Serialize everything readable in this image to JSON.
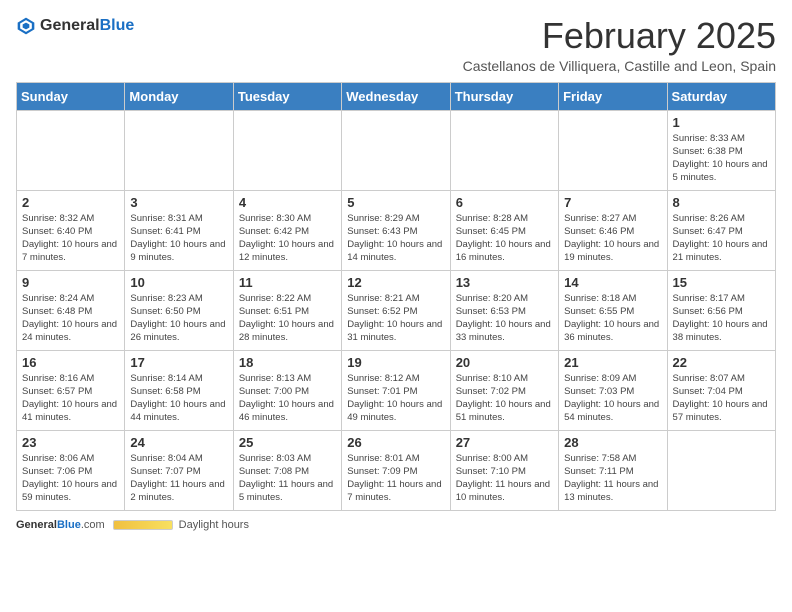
{
  "header": {
    "logo_general": "General",
    "logo_blue": "Blue",
    "title": "February 2025",
    "subtitle": "Castellanos de Villiquera, Castille and Leon, Spain"
  },
  "calendar": {
    "days_of_week": [
      "Sunday",
      "Monday",
      "Tuesday",
      "Wednesday",
      "Thursday",
      "Friday",
      "Saturday"
    ],
    "weeks": [
      [
        {
          "day": "",
          "info": ""
        },
        {
          "day": "",
          "info": ""
        },
        {
          "day": "",
          "info": ""
        },
        {
          "day": "",
          "info": ""
        },
        {
          "day": "",
          "info": ""
        },
        {
          "day": "",
          "info": ""
        },
        {
          "day": "1",
          "info": "Sunrise: 8:33 AM\nSunset: 6:38 PM\nDaylight: 10 hours and 5 minutes."
        }
      ],
      [
        {
          "day": "2",
          "info": "Sunrise: 8:32 AM\nSunset: 6:40 PM\nDaylight: 10 hours and 7 minutes."
        },
        {
          "day": "3",
          "info": "Sunrise: 8:31 AM\nSunset: 6:41 PM\nDaylight: 10 hours and 9 minutes."
        },
        {
          "day": "4",
          "info": "Sunrise: 8:30 AM\nSunset: 6:42 PM\nDaylight: 10 hours and 12 minutes."
        },
        {
          "day": "5",
          "info": "Sunrise: 8:29 AM\nSunset: 6:43 PM\nDaylight: 10 hours and 14 minutes."
        },
        {
          "day": "6",
          "info": "Sunrise: 8:28 AM\nSunset: 6:45 PM\nDaylight: 10 hours and 16 minutes."
        },
        {
          "day": "7",
          "info": "Sunrise: 8:27 AM\nSunset: 6:46 PM\nDaylight: 10 hours and 19 minutes."
        },
        {
          "day": "8",
          "info": "Sunrise: 8:26 AM\nSunset: 6:47 PM\nDaylight: 10 hours and 21 minutes."
        }
      ],
      [
        {
          "day": "9",
          "info": "Sunrise: 8:24 AM\nSunset: 6:48 PM\nDaylight: 10 hours and 24 minutes."
        },
        {
          "day": "10",
          "info": "Sunrise: 8:23 AM\nSunset: 6:50 PM\nDaylight: 10 hours and 26 minutes."
        },
        {
          "day": "11",
          "info": "Sunrise: 8:22 AM\nSunset: 6:51 PM\nDaylight: 10 hours and 28 minutes."
        },
        {
          "day": "12",
          "info": "Sunrise: 8:21 AM\nSunset: 6:52 PM\nDaylight: 10 hours and 31 minutes."
        },
        {
          "day": "13",
          "info": "Sunrise: 8:20 AM\nSunset: 6:53 PM\nDaylight: 10 hours and 33 minutes."
        },
        {
          "day": "14",
          "info": "Sunrise: 8:18 AM\nSunset: 6:55 PM\nDaylight: 10 hours and 36 minutes."
        },
        {
          "day": "15",
          "info": "Sunrise: 8:17 AM\nSunset: 6:56 PM\nDaylight: 10 hours and 38 minutes."
        }
      ],
      [
        {
          "day": "16",
          "info": "Sunrise: 8:16 AM\nSunset: 6:57 PM\nDaylight: 10 hours and 41 minutes."
        },
        {
          "day": "17",
          "info": "Sunrise: 8:14 AM\nSunset: 6:58 PM\nDaylight: 10 hours and 44 minutes."
        },
        {
          "day": "18",
          "info": "Sunrise: 8:13 AM\nSunset: 7:00 PM\nDaylight: 10 hours and 46 minutes."
        },
        {
          "day": "19",
          "info": "Sunrise: 8:12 AM\nSunset: 7:01 PM\nDaylight: 10 hours and 49 minutes."
        },
        {
          "day": "20",
          "info": "Sunrise: 8:10 AM\nSunset: 7:02 PM\nDaylight: 10 hours and 51 minutes."
        },
        {
          "day": "21",
          "info": "Sunrise: 8:09 AM\nSunset: 7:03 PM\nDaylight: 10 hours and 54 minutes."
        },
        {
          "day": "22",
          "info": "Sunrise: 8:07 AM\nSunset: 7:04 PM\nDaylight: 10 hours and 57 minutes."
        }
      ],
      [
        {
          "day": "23",
          "info": "Sunrise: 8:06 AM\nSunset: 7:06 PM\nDaylight: 10 hours and 59 minutes."
        },
        {
          "day": "24",
          "info": "Sunrise: 8:04 AM\nSunset: 7:07 PM\nDaylight: 11 hours and 2 minutes."
        },
        {
          "day": "25",
          "info": "Sunrise: 8:03 AM\nSunset: 7:08 PM\nDaylight: 11 hours and 5 minutes."
        },
        {
          "day": "26",
          "info": "Sunrise: 8:01 AM\nSunset: 7:09 PM\nDaylight: 11 hours and 7 minutes."
        },
        {
          "day": "27",
          "info": "Sunrise: 8:00 AM\nSunset: 7:10 PM\nDaylight: 11 hours and 10 minutes."
        },
        {
          "day": "28",
          "info": "Sunrise: 7:58 AM\nSunset: 7:11 PM\nDaylight: 11 hours and 13 minutes."
        },
        {
          "day": "",
          "info": ""
        }
      ]
    ]
  },
  "footer": {
    "logo": "GeneralBlue",
    "daylight_label": "Daylight hours",
    "website": "GeneralBlue.com"
  }
}
